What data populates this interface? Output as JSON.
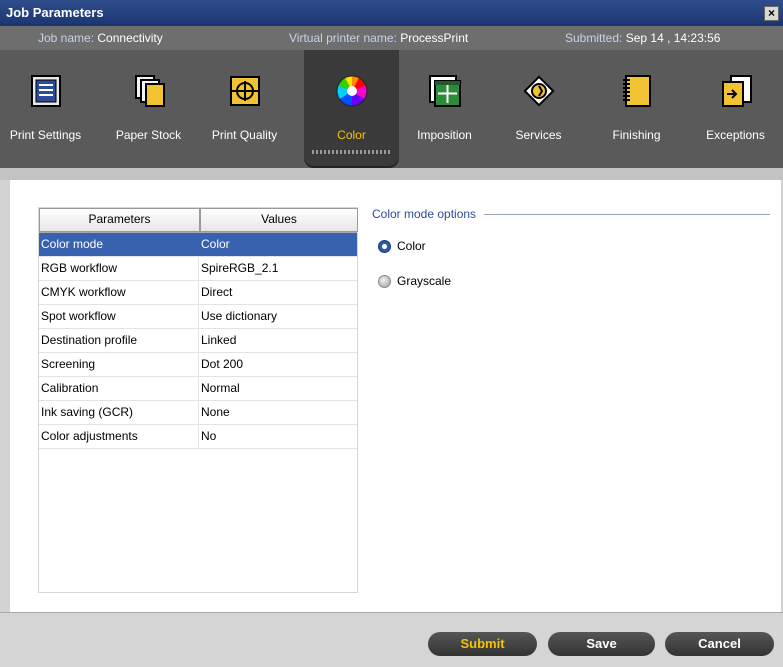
{
  "window": {
    "title": "Job Parameters",
    "close_label": "×"
  },
  "info": {
    "job_label": "Job name:",
    "job_value": "Connectivity",
    "printer_label": "Virtual printer name:",
    "printer_value": "ProcessPrint",
    "submitted_label": "Submitted:",
    "submitted_value": "Sep 14 , 14:23:56"
  },
  "toolbar": {
    "items": [
      {
        "label": "Print Settings",
        "icon": "print-settings-icon"
      },
      {
        "label": "Paper Stock",
        "icon": "paper-stock-icon"
      },
      {
        "label": "Print Quality",
        "icon": "print-quality-icon"
      },
      {
        "label": "Color",
        "icon": "color-wheel-icon",
        "selected": true
      },
      {
        "label": "Imposition",
        "icon": "imposition-icon"
      },
      {
        "label": "Services",
        "icon": "services-icon"
      },
      {
        "label": "Finishing",
        "icon": "finishing-icon"
      },
      {
        "label": "Exceptions",
        "icon": "exceptions-icon"
      }
    ]
  },
  "table": {
    "col_params": "Parameters",
    "col_values": "Values",
    "rows": [
      {
        "param": "Color mode",
        "value": "Color",
        "selected": true
      },
      {
        "param": "RGB workflow",
        "value": "SpireRGB_2.1"
      },
      {
        "param": "CMYK workflow",
        "value": "Direct"
      },
      {
        "param": "Spot workflow",
        "value": "Use dictionary"
      },
      {
        "param": "Destination profile",
        "value": "Linked"
      },
      {
        "param": "Screening",
        "value": "Dot 200"
      },
      {
        "param": "Calibration",
        "value": "Normal"
      },
      {
        "param": "Ink saving (GCR)",
        "value": "None"
      },
      {
        "param": "Color adjustments",
        "value": "No"
      }
    ]
  },
  "options": {
    "title": "Color mode options",
    "radios": [
      {
        "label": "Color",
        "checked": true
      },
      {
        "label": "Grayscale",
        "checked": false
      }
    ]
  },
  "buttons": {
    "submit": "Submit",
    "save": "Save",
    "cancel": "Cancel"
  },
  "colors": {
    "accent": "#f5c400",
    "selection": "#3862b0",
    "titlebar": "#1b3570"
  }
}
